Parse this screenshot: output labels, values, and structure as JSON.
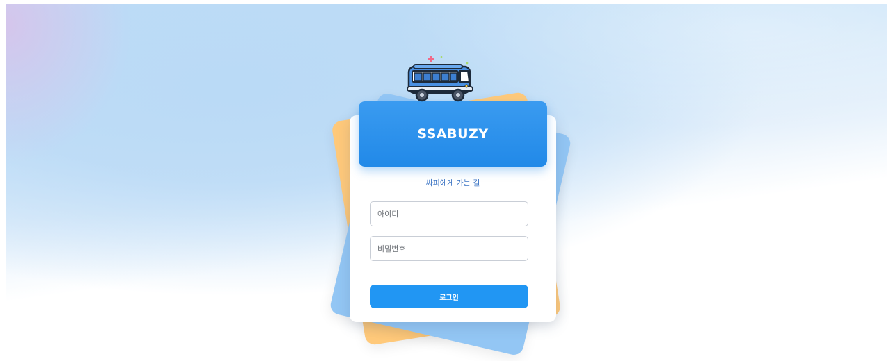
{
  "brand": {
    "title": "SSABUZY",
    "subtitle": "싸피에게 가는 길",
    "logo_icon": "bus-icon"
  },
  "login_form": {
    "id_placeholder": "아이디",
    "password_placeholder": "비밀번호",
    "submit_label": "로그인"
  },
  "colors": {
    "accent": "#2196f3",
    "header_gradient_top": "#3a9bf0",
    "header_gradient_bottom": "#2189e8",
    "sheet_orange": "#ffc97a",
    "sheet_blue": "#93c6f4",
    "subtitle": "#3b74c4"
  }
}
